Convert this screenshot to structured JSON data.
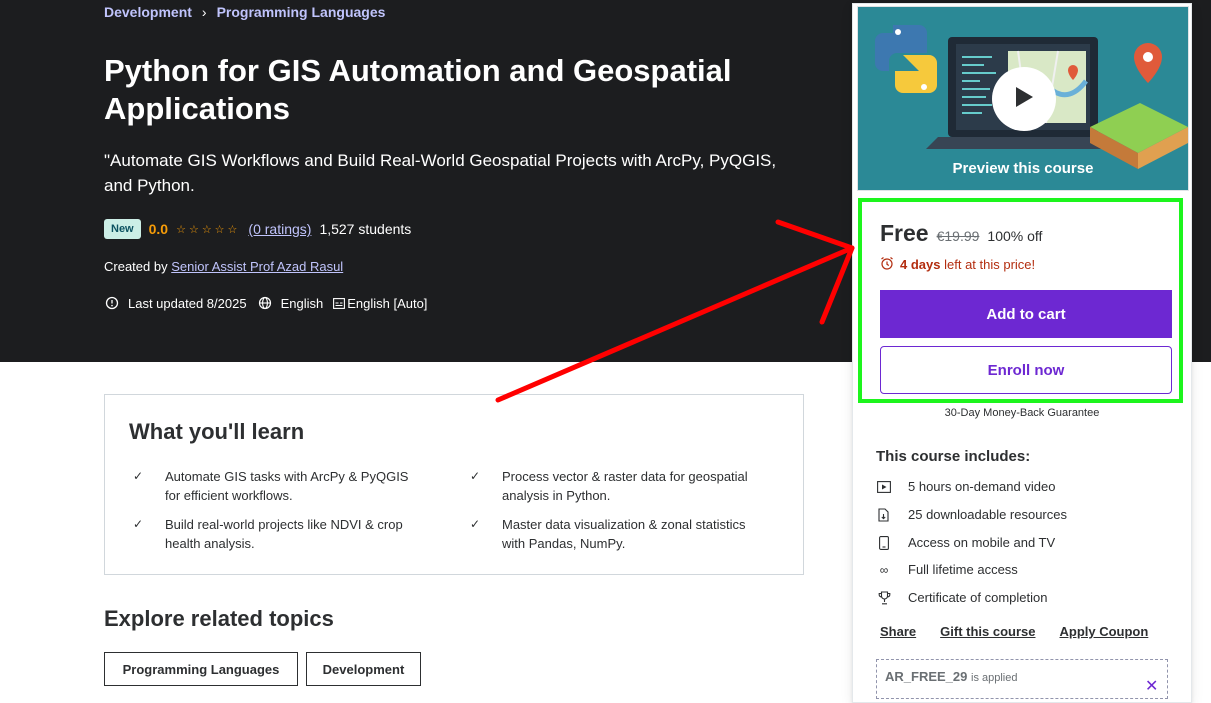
{
  "breadcrumb": {
    "items": [
      "Development",
      "Programming Languages"
    ],
    "separator": "›"
  },
  "course": {
    "title": "Python for GIS Automation and Geospatial Applications",
    "subtitle": "\"Automate GIS Workflows and Build Real-World Geospatial Projects with ArcPy, PyQGIS, and Python.",
    "badge": "New",
    "rating": "0.0",
    "stars": "☆☆☆☆☆",
    "ratings_link": "(0 ratings)",
    "students": "1,527 students",
    "created_by_label": "Created by",
    "instructor": "Senior Assist Prof Azad Rasul",
    "last_updated": "Last updated 8/2025",
    "language": "English",
    "captions": "English [Auto]"
  },
  "learn": {
    "title": "What you'll learn",
    "items": [
      "Automate GIS tasks with ArcPy & PyQGIS for efficient workflows.",
      "Process vector & raster data for geospatial analysis in Python.",
      "Build real-world projects like NDVI & crop health analysis.",
      "Master data visualization & zonal statistics with Pandas, NumPy."
    ]
  },
  "topics": {
    "title": "Explore related topics",
    "items": [
      "Programming Languages",
      "Development"
    ]
  },
  "sidebar": {
    "preview_label": "Preview this course",
    "price": "Free",
    "original_price": "€19.99",
    "discount": "100% off",
    "timer_bold": "4 days",
    "timer_rest": "left at this price!",
    "add_to_cart": "Add to cart",
    "enroll_now": "Enroll now",
    "guarantee": "30-Day Money-Back Guarantee",
    "includes_title": "This course includes:",
    "includes": [
      {
        "icon": "video-icon",
        "label": "5 hours on-demand video"
      },
      {
        "icon": "download-file-icon",
        "label": "25 downloadable resources"
      },
      {
        "icon": "mobile-icon",
        "label": "Access on mobile and TV"
      },
      {
        "icon": "infinity-icon",
        "label": "Full lifetime access"
      },
      {
        "icon": "trophy-icon",
        "label": "Certificate of completion"
      }
    ],
    "share": "Share",
    "gift": "Gift this course",
    "apply_coupon": "Apply Coupon",
    "coupon_code": "AR_FREE_29",
    "coupon_applied": "is applied"
  },
  "colors": {
    "hero_bg": "#1c1d1f",
    "accent_purple": "#6d28d2",
    "link_lavender": "#c0c4fc",
    "rating_orange": "#f69c08",
    "timer_red": "#b32d0f",
    "highlight_green": "#1df51d",
    "annotation_red": "#ff0000"
  }
}
